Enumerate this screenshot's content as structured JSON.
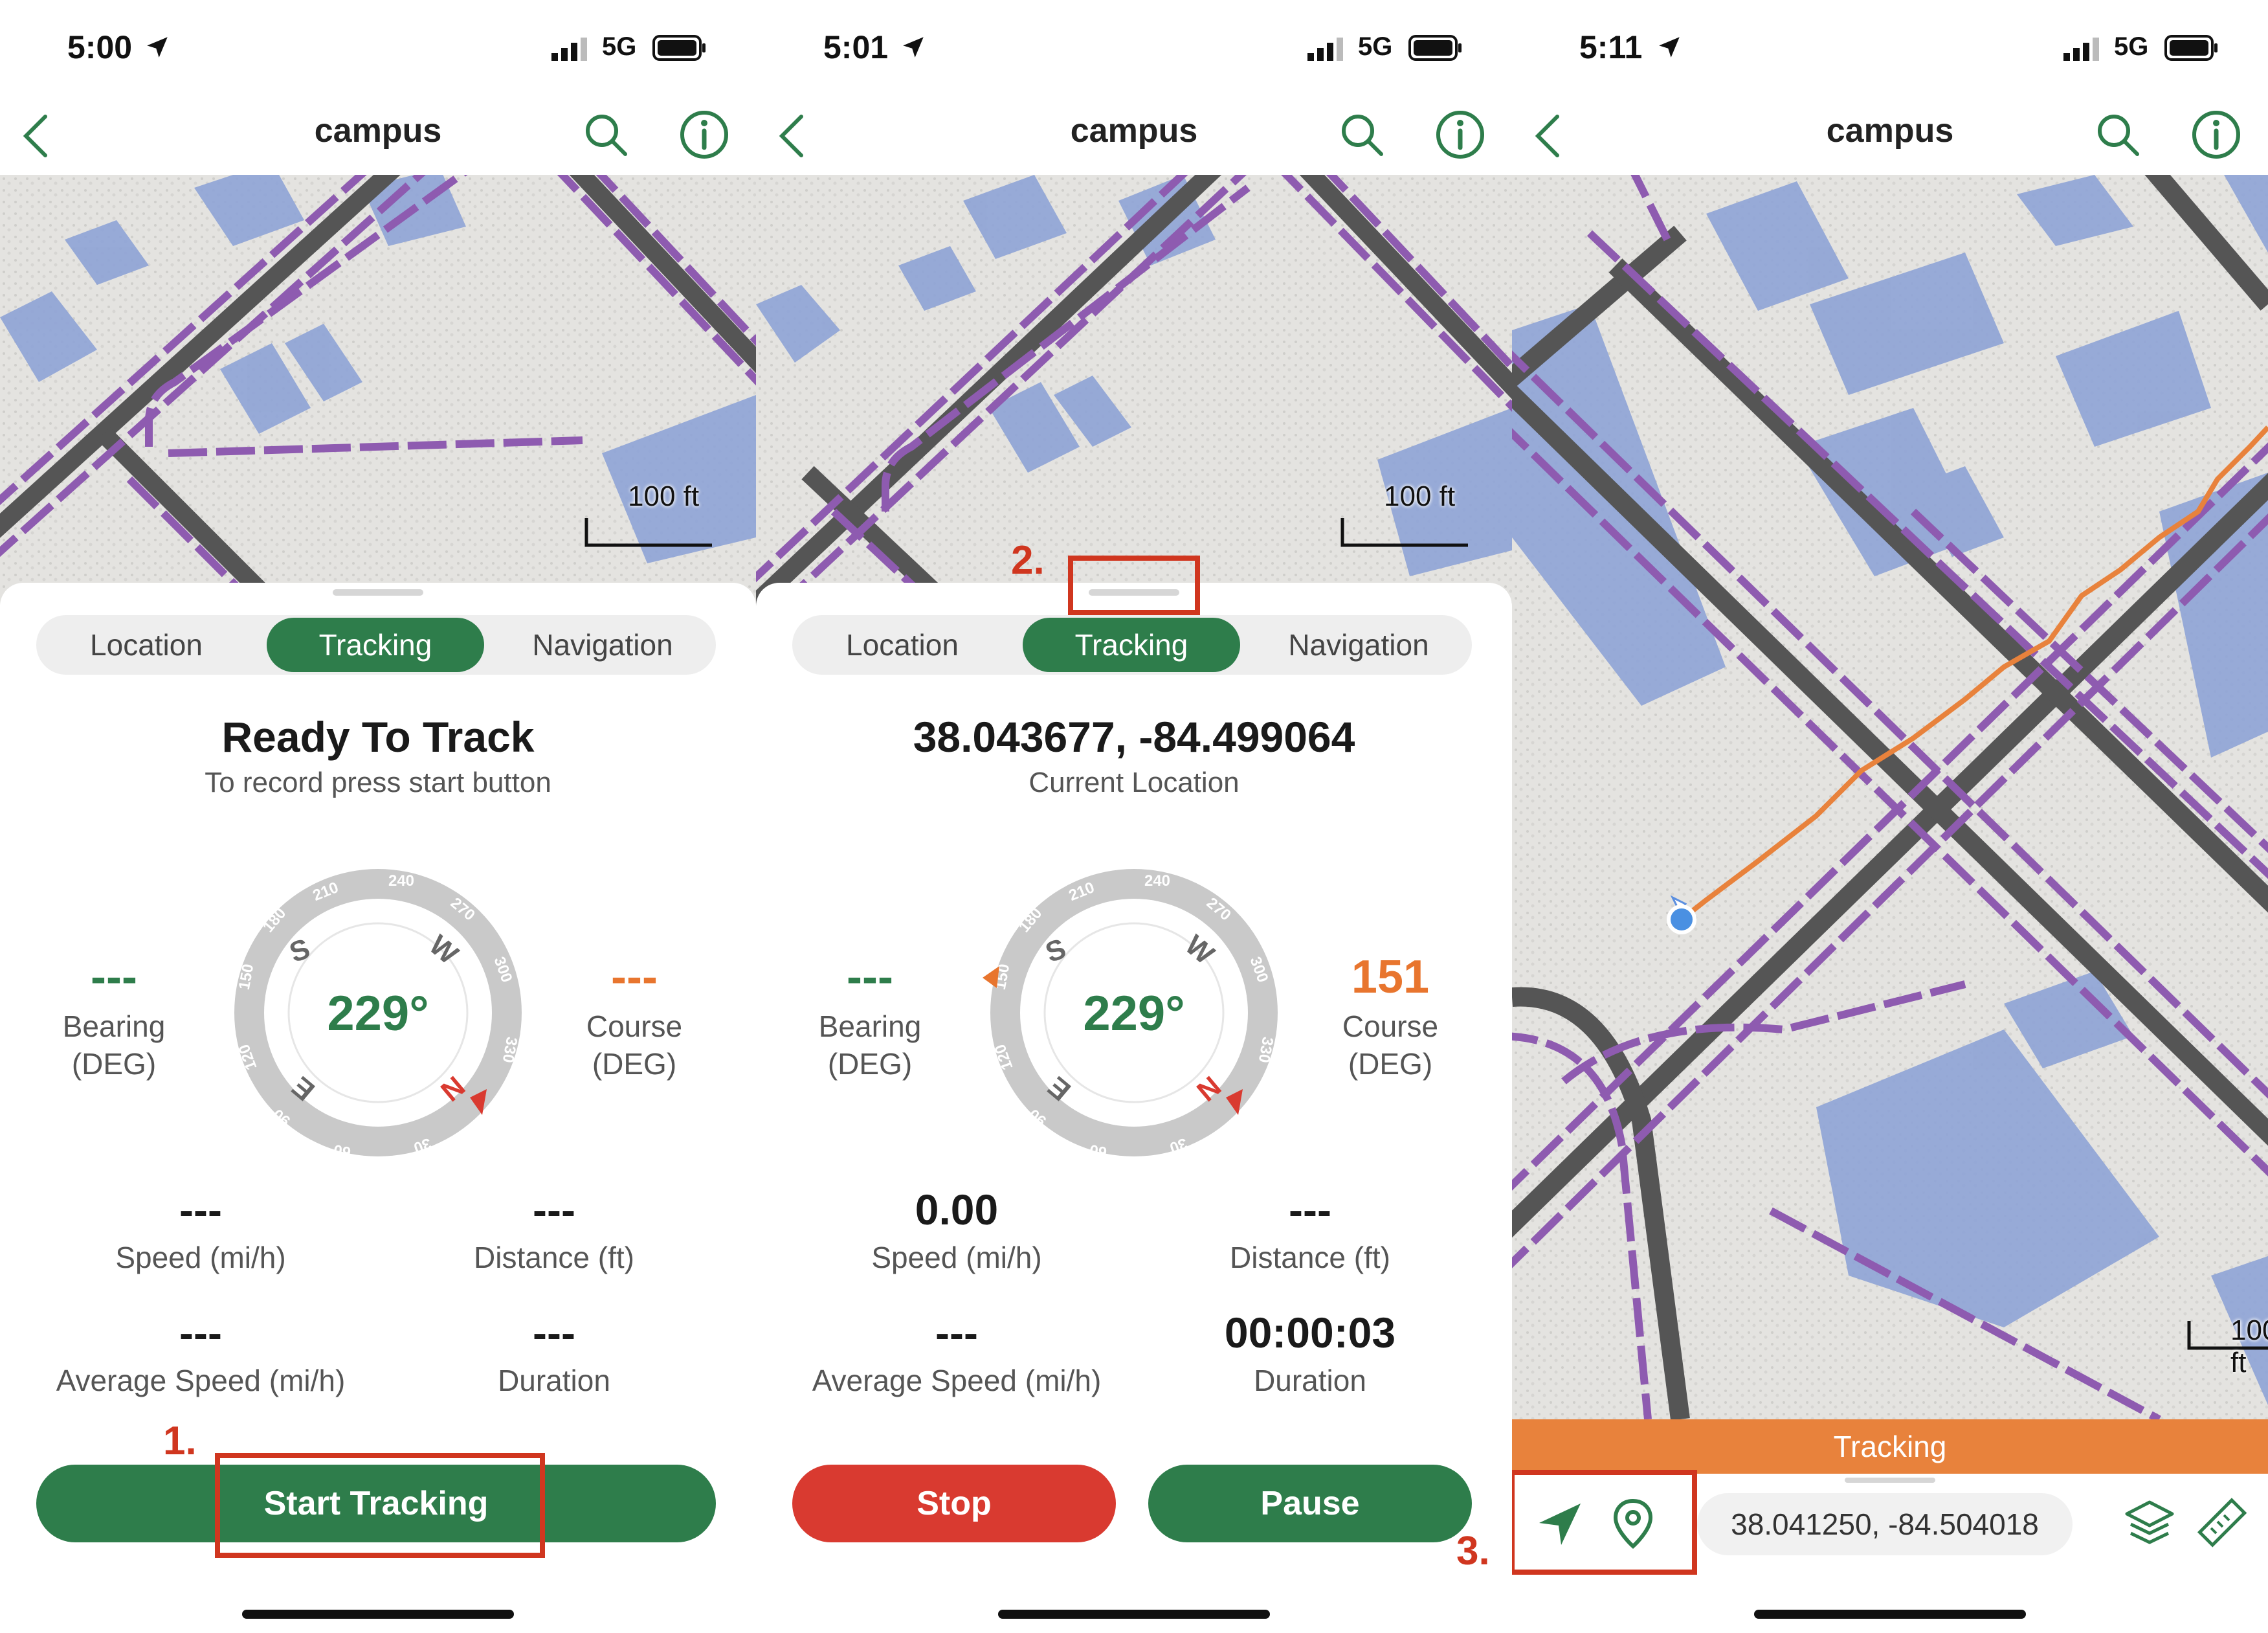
{
  "screens": [
    {
      "status": {
        "time": "5:00",
        "network": "5G"
      },
      "nav": {
        "title": "campus"
      },
      "map": {
        "scale_label": "100 ft"
      },
      "tabs": [
        "Location",
        "Tracking",
        "Navigation"
      ],
      "active_tab": "Tracking",
      "headline": "Ready To Track",
      "subline": "To record press start button",
      "bearing": {
        "value": "---",
        "label": "Bearing\n(DEG)"
      },
      "course": {
        "value": "---",
        "label": "Course\n(DEG)"
      },
      "compass": {
        "heading": "229°",
        "ticks": [
          "210",
          "240",
          "270",
          "300",
          "330",
          "30",
          "60",
          "90",
          "120",
          "150",
          "180"
        ],
        "cardinals": [
          "S",
          "W",
          "N",
          "E"
        ]
      },
      "stats": [
        {
          "value": "---",
          "label": "Speed (mi/h)"
        },
        {
          "value": "---",
          "label": "Distance (ft)"
        },
        {
          "value": "---",
          "label": "Average Speed (mi/h)"
        },
        {
          "value": "---",
          "label": "Duration"
        }
      ],
      "button": "Start Tracking",
      "annotation": "1."
    },
    {
      "status": {
        "time": "5:01",
        "network": "5G"
      },
      "nav": {
        "title": "campus"
      },
      "map": {
        "scale_label": "100 ft"
      },
      "tabs": [
        "Location",
        "Tracking",
        "Navigation"
      ],
      "active_tab": "Tracking",
      "headline": "38.043677, -84.499064",
      "subline": "Current Location",
      "bearing": {
        "value": "---",
        "label": "Bearing\n(DEG)"
      },
      "course": {
        "value": "151",
        "label": "Course\n(DEG)"
      },
      "compass": {
        "heading": "229°"
      },
      "stats": [
        {
          "value": "0.00",
          "label": "Speed (mi/h)"
        },
        {
          "value": "---",
          "label": "Distance (ft)"
        },
        {
          "value": "---",
          "label": "Average Speed (mi/h)"
        },
        {
          "value": "00:00:03",
          "label": "Duration"
        }
      ],
      "buttons": {
        "stop": "Stop",
        "pause": "Pause"
      },
      "annotation": "2."
    },
    {
      "status": {
        "time": "5:11",
        "network": "5G"
      },
      "nav": {
        "title": "campus"
      },
      "map": {
        "scale_label": "100 ft"
      },
      "tracking_banner": "Tracking",
      "coordinates": "38.041250, -84.504018",
      "annotation": "3."
    }
  ],
  "colors": {
    "brand_green": "#2e7d4b",
    "stop_red": "#d93a30",
    "course_orange": "#e8752e",
    "annotation_red": "#d0361f",
    "building_blue": "#8ea3d6",
    "path_purple": "#8e5bb0",
    "road_gray": "#555555"
  }
}
